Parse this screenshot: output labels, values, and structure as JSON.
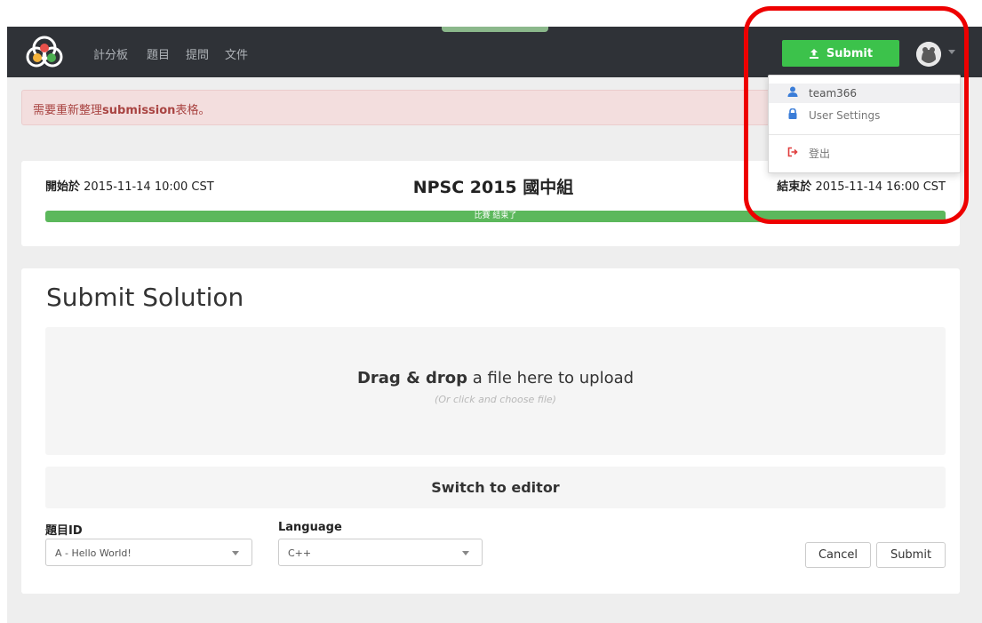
{
  "navbar": {
    "links": [
      "計分板",
      "題目",
      "提問",
      "文件"
    ],
    "submit_label": "Submit",
    "accent_color": "#3cc24b",
    "background_color": "#2f3237"
  },
  "user_menu": {
    "items": [
      {
        "label": "team366",
        "icon": "user-icon",
        "color": "#3b7dd8"
      },
      {
        "label": "User Settings",
        "icon": "lock-icon",
        "color": "#3b7dd8"
      },
      {
        "label": "登出",
        "icon": "sign-out-icon",
        "color": "#e03d3d"
      }
    ]
  },
  "alert": {
    "prefix": "需要重新整理",
    "strong": "submission",
    "suffix": "表格。"
  },
  "contest": {
    "start_label": "開始於",
    "start_time": "2015-11-14 10:00 CST",
    "title": "NPSC 2015 國中組",
    "end_label": "結束於",
    "end_time": "2015-11-14 16:00 CST",
    "progress_text": "比賽 結束了",
    "progress_fraction": 1.0
  },
  "submit_form": {
    "heading": "Submit Solution",
    "drop_strong": "Drag & drop",
    "drop_rest": " a file here to upload",
    "drop_hint": "(Or click and choose file)",
    "switch_editor": "Switch to editor",
    "problem_label": "題目ID",
    "problem_value": "A - Hello World!",
    "language_label": "Language",
    "language_value": "C++",
    "cancel_label": "Cancel",
    "submit_label": "Submit"
  }
}
